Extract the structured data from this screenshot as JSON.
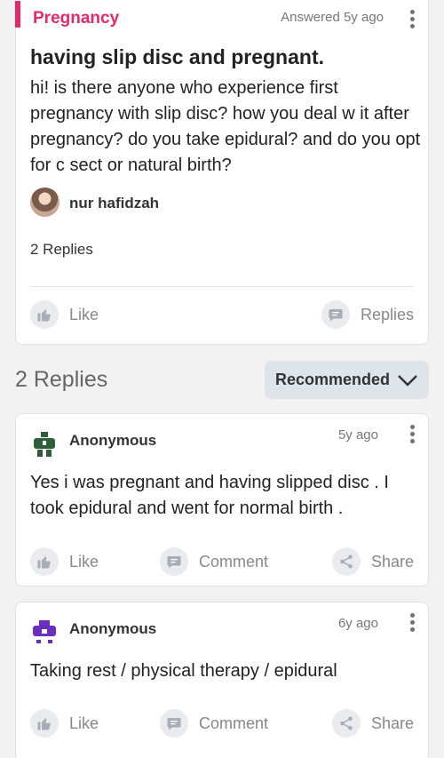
{
  "question": {
    "category": "Pregnancy",
    "answered_time": "Answered 5y ago",
    "title": "having slip disc and pregnant.",
    "body": "hi! is there anyone who experience first pregnancy with slip disc? how you deal w it after pregnancy? do you take epidural? and do you opt for c sect or natural birth?",
    "author": "nur hafidzah",
    "reply_count": "2 Replies",
    "like_label": "Like",
    "replies_label": "Replies"
  },
  "replies_section": {
    "title": "2 Replies",
    "sort_label": "Recommended"
  },
  "replies": [
    {
      "author": "Anonymous",
      "time": "5y ago",
      "body": "Yes i was pregnant and having slipped disc . I took epidural and went for normal birth .",
      "like_label": "Like",
      "comment_label": "Comment",
      "share_label": "Share",
      "avatar_color": "#2f5e3a"
    },
    {
      "author": "Anonymous",
      "time": "6y ago",
      "body": "Taking rest / physical therapy / epidural",
      "like_label": "Like",
      "comment_label": "Comment",
      "share_label": "Share",
      "avatar_color": "#6a2fc0"
    }
  ],
  "colors": {
    "accent": "#e8286a",
    "icon_gray": "#9aa1ab"
  },
  "icons": [
    "kebab-menu-icon",
    "thumbs-up-icon",
    "chat-bubble-icon",
    "share-icon",
    "chevron-down-icon",
    "anonymous-avatar-icon"
  ]
}
